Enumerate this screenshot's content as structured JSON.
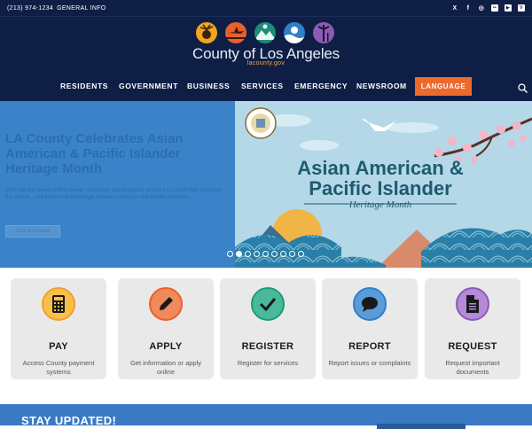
{
  "topbar": {
    "phone": "(213) 974-1234",
    "info": "GENERAL INFO",
    "social": [
      {
        "icon": "x-icon",
        "glyph": "X"
      },
      {
        "icon": "facebook-icon",
        "glyph": "f"
      },
      {
        "icon": "instagram-icon",
        "glyph": "◎"
      },
      {
        "icon": "flickr-icon",
        "glyph": "••"
      },
      {
        "icon": "youtube-icon",
        "glyph": "▶"
      },
      {
        "icon": "vimeo-icon",
        "glyph": "V"
      }
    ]
  },
  "header": {
    "title": "County of Los Angeles",
    "subtitle": "lacounty.gov",
    "logo_icon_colors": [
      "#f2a51d",
      "#e8612c",
      "#1f8c7b",
      "#2f7fc8",
      "#8c5cb5"
    ]
  },
  "nav": {
    "items": [
      "RESIDENTS",
      "GOVERNMENT",
      "BUSINESS",
      "SERVICES",
      "EMERGENCY",
      "NEWSROOM"
    ],
    "language": "LANGUAGE",
    "accent": "#ec6a2c"
  },
  "hero": {
    "title": "LA County Celebrates Asian American & Pacific Islander Heritage Month",
    "body": "Click the link below to find events, resources and programs across LA County that celebrate the culture, contributions and heritage of Asian American and Pacific Islanders.",
    "button": "Click for Details",
    "banner_title_line1": "Asian American &",
    "banner_title_line2": "Pacific Islander",
    "banner_subtitle": "Heritage Month",
    "slide_count": 9,
    "active_slide": 2
  },
  "cards": [
    {
      "title": "PAY",
      "desc": "Access County payment systems",
      "icon": "calculator-icon",
      "color": "#f0a02a"
    },
    {
      "title": "APPLY",
      "desc": "Get information or apply online",
      "icon": "pencil-icon",
      "color": "#e8612c"
    },
    {
      "title": "REGISTER",
      "desc": "Register for services",
      "icon": "checkmark-icon",
      "color": "#1e9a7e"
    },
    {
      "title": "REPORT",
      "desc": "Report issues or complaints",
      "icon": "speech-bubble-icon",
      "color": "#2f7fc8"
    },
    {
      "title": "REQUEST",
      "desc": "Request important documents",
      "icon": "document-icon",
      "color": "#8c5cb5"
    }
  ],
  "stay": {
    "title": "STAY UPDATED!"
  }
}
